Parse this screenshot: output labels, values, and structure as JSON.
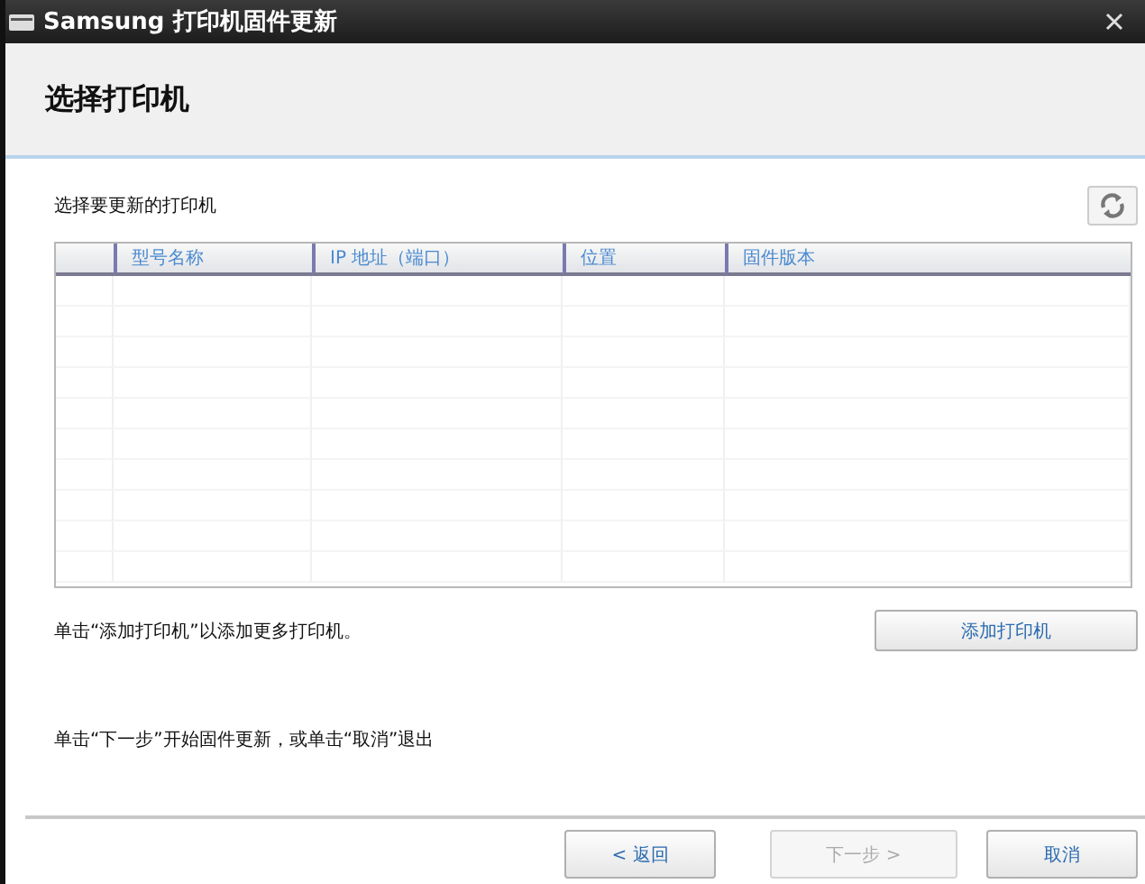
{
  "window": {
    "title": "Samsung 打印机固件更新"
  },
  "header": {
    "title": "选择打印机"
  },
  "instruction": "选择要更新的打印机",
  "table": {
    "columns": [
      "",
      "型号名称",
      "IP 地址（端口）",
      "位置",
      "固件版本"
    ]
  },
  "add_hint": "单击“添加打印机”以添加更多打印机。",
  "add_button": "添加打印机",
  "next_hint": "单击“下一步”开始固件更新，或单击“取消”退出",
  "buttons": [
    {
      "label": "< 返回",
      "disabled": false
    },
    {
      "label": "下一步 >",
      "disabled": true
    },
    {
      "label": "取消",
      "disabled": false
    }
  ]
}
